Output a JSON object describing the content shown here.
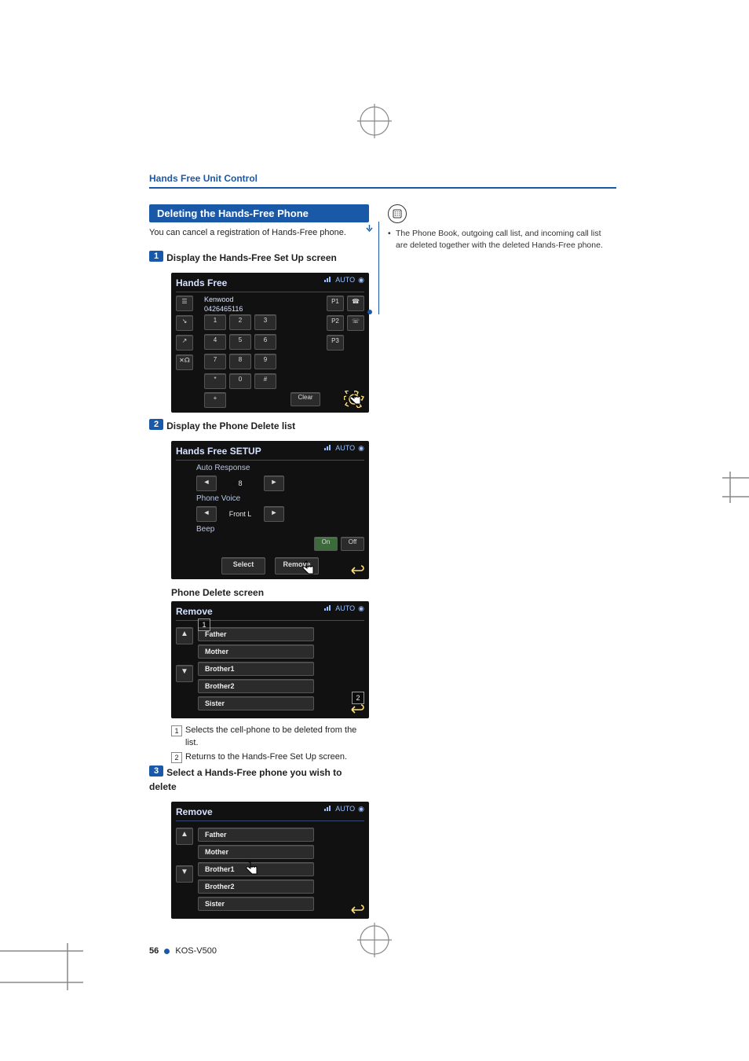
{
  "header": {
    "running": "Hands Free Unit Control"
  },
  "section": {
    "title": "Deleting the Hands-Free Phone",
    "intro": "You can cancel a registration of Hands-Free phone."
  },
  "steps": {
    "s1": {
      "num": "1",
      "label": "Display the Hands-Free Set Up screen"
    },
    "s2": {
      "num": "2",
      "label": "Display the Phone Delete list"
    },
    "s3": {
      "num": "3",
      "label": "Select a Hands-Free phone you wish to delete"
    }
  },
  "dialer": {
    "title": "Hands Free",
    "brand": "Kenwood",
    "number": "0426465116",
    "keys": [
      "1",
      "2",
      "3",
      "4",
      "5",
      "6",
      "7",
      "8",
      "9",
      "*",
      "0",
      "#"
    ],
    "clear": "Clear",
    "presets": [
      "P1",
      "P2",
      "P3"
    ],
    "plus": "+",
    "auto": "AUTO"
  },
  "setup": {
    "title": "Hands Free SETUP",
    "rows": {
      "auto_response": {
        "label": "Auto Response",
        "value": "8"
      },
      "phone_voice": {
        "label": "Phone Voice",
        "value": "Front L"
      },
      "beep": {
        "label": "Beep",
        "on": "On",
        "off": "Off"
      }
    },
    "buttons": {
      "select": "Select",
      "remove": "Remove"
    }
  },
  "delete_screen_head": "Phone Delete screen",
  "remove_list": {
    "title": "Remove",
    "items": [
      "Father",
      "Mother",
      "Brother1",
      "Brother2",
      "Sister"
    ],
    "callout1": "1",
    "callout2": "2"
  },
  "callouts": {
    "c1": "Selects the cell-phone to be deleted from the list.",
    "c2": "Returns to the Hands-Free Set Up screen."
  },
  "note": {
    "text": "The Phone Book, outgoing call list, and incoming call list are deleted together with the deleted Hands-Free phone."
  },
  "footer": {
    "page": "56",
    "model": "KOS-V500"
  }
}
